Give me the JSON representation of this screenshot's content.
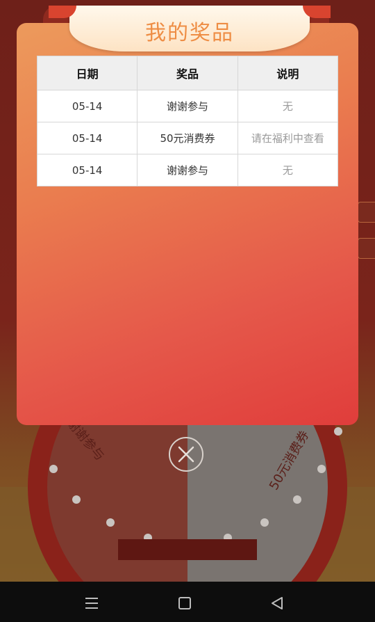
{
  "modal": {
    "title": "我的奖品",
    "columns": [
      "日期",
      "奖品",
      "说明"
    ],
    "rows": [
      {
        "date": "05-14",
        "prize": "谢谢参与",
        "note": "无"
      },
      {
        "date": "05-14",
        "prize": "50元消费券",
        "note": "请在福利中查看"
      },
      {
        "date": "05-14",
        "prize": "谢谢参与",
        "note": "无"
      }
    ]
  },
  "background": {
    "wheel_segment_left": "谢谢参与",
    "wheel_segment_right": "50元消费券"
  },
  "colors": {
    "modal_gradient_start": "#ec9a5c",
    "modal_gradient_end": "#e03d3b",
    "title_text": "#ee8d44",
    "note_text": "#9a9a9a"
  },
  "icons": {
    "close": "close-icon",
    "nav_menu": "menu-icon",
    "nav_home": "home-icon",
    "nav_back": "back-icon"
  }
}
